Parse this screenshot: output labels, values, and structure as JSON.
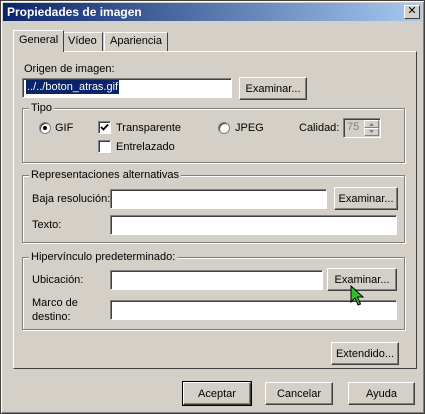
{
  "window": {
    "title": "Propiedades de imagen",
    "close_glyph": "✕"
  },
  "tabs": [
    {
      "label": "General",
      "active": true
    },
    {
      "label": "Vídeo",
      "active": false
    },
    {
      "label": "Apariencia",
      "active": false
    }
  ],
  "origin": {
    "label": "Origen de imagen:",
    "value": "../../boton_atras.gif",
    "browse_label": "Examinar..."
  },
  "type_group": {
    "legend": "Tipo",
    "gif_label": "GIF",
    "gif_selected": true,
    "transparent_label": "Transparente",
    "transparent_checked": true,
    "interlaced_label": "Entrelazado",
    "interlaced_checked": false,
    "jpeg_label": "JPEG",
    "jpeg_selected": false,
    "quality_label": "Calidad:",
    "quality_value": "75"
  },
  "alt_group": {
    "legend": "Representaciones alternativas",
    "lowres_label": "Baja resolución:",
    "lowres_value": "",
    "browse_label": "Examinar...",
    "text_label": "Texto:",
    "text_value": ""
  },
  "link_group": {
    "legend": "Hipervínculo predeterminado:",
    "location_label": "Ubicación:",
    "location_value": "",
    "browse_label": "Examinar...",
    "target_label_1": "Marco de",
    "target_label_2": "destino:",
    "target_value": ""
  },
  "extended_label": "Extendido...",
  "footer": {
    "ok_label": "Aceptar",
    "cancel_label": "Cancelar",
    "help_label": "Ayuda"
  },
  "cursor_icon": "arrow-pointer",
  "cursor_color": "#2fbf2f"
}
